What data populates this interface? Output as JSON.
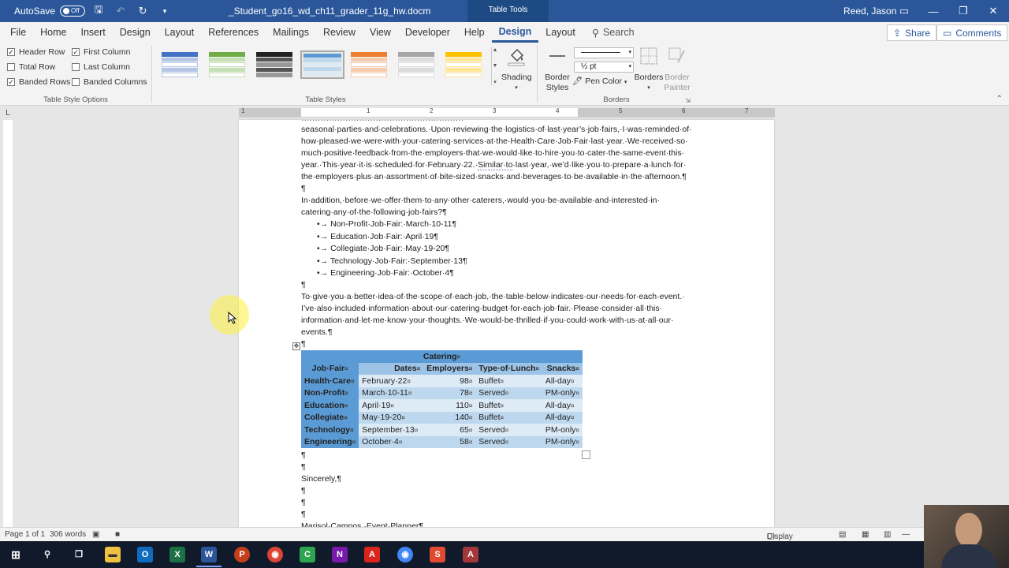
{
  "titlebar": {
    "autosave_label": "AutoSave",
    "autosave_state": "Off",
    "document_title": "_Student_go16_wd_ch11_grader_11g_hw.docm",
    "context_label": "Table Tools",
    "user": "Reed, Jason"
  },
  "menu": {
    "items": [
      "File",
      "Home",
      "Insert",
      "Design",
      "Layout",
      "References",
      "Mailings",
      "Review",
      "View",
      "Developer",
      "Help",
      "Design",
      "Layout"
    ],
    "search": "Search",
    "share": "Share",
    "comments": "Comments"
  },
  "ribbon": {
    "style_options": {
      "header_row": "Header Row",
      "total_row": "Total Row",
      "banded_rows": "Banded Rows",
      "first_column": "First Column",
      "last_column": "Last Column",
      "banded_columns": "Banded Columns",
      "group_label": "Table Style Options"
    },
    "table_styles_label": "Table Styles",
    "shading": "Shading",
    "border_styles_1": "Border",
    "border_styles_2": "Styles",
    "pen_weight": "½ pt",
    "pen_color": "Pen Color",
    "borders": "Borders",
    "border_painter_1": "Border",
    "border_painter_2": "Painter",
    "borders_group_label": "Borders"
  },
  "ruler": {
    "numbers": [
      "1",
      "1",
      "2",
      "3",
      "4",
      "5",
      "6",
      "7"
    ]
  },
  "document": {
    "lines": [
      "seasonal·parties·and·celebrations.·Upon·reviewing·the·logistics·of·last·year’s·job·fairs,·I·was·reminded·of·",
      "how·pleased·we·were·with·your·catering·services·at·the·Health·Care·Job·Fair·last·year.·We·received·so·",
      "much·positive·feedback·from·the·employers·that·we·would·like·to·hire·you·to·cater·the·same·event·this·",
      "year.·This·year·it·is·scheduled·for·February·22.·",
      "Similar·to",
      "·last·year,·we’d·like·you·to·prepare·a·lunch·for·",
      "the·employers·plus·an·assortment·of·bite-sized·snacks·and·beverages·to·be·available·in·the·afternoon.¶",
      "¶",
      "In·addition,·before·we·offer·them·to·any·other·caterers,·would·you·be·available·and·interested·in·",
      "catering·any·of·the·following·job·fairs?¶"
    ],
    "bullets": [
      "•→ Non-Profit·Job·Fair:·March·10-11¶",
      "•→ Education·Job·Fair:·April·19¶",
      "•→ Collegiate·Job·Fair:·May·19-20¶",
      "•→ Technology·Job·Fair:·September·13¶",
      "•→ Engineering·Job·Fair:·October·4¶"
    ],
    "pilcrow": "¶",
    "para2": [
      "To·give·you·a·better·idea·of·the·scope·of·each·job,·the·table·below·indicates·our·needs·for·each·event.·",
      "I’ve·also·included·information·about·our·catering·budget·for·each·job·fair.·Please·consider·all·this·",
      "information·and·let·me·know·your·thoughts.·We·would·be·thrilled·if·you·could·work·with·us·at·all·our·",
      "events.¶"
    ],
    "sincerely": "Sincerely,¶",
    "signature": "Marisol·Campos,·Event·Planner¶"
  },
  "table": {
    "title": "Catering",
    "cell_mark": "¤",
    "headers": [
      "Job·Fair",
      "Dates",
      "Employers",
      "Type·of·Lunch",
      "Snacks"
    ],
    "rows": [
      [
        "Health·Care",
        "February·22",
        "98",
        "Buffet",
        "All-day"
      ],
      [
        "Non-Profit",
        "March·10-11",
        "78",
        "Served",
        "PM-only"
      ],
      [
        "Education",
        "April·19",
        "110",
        "Buffet",
        "All-day"
      ],
      [
        "Collegiate",
        "May·19-20",
        "140",
        "Buffet",
        "All-day"
      ],
      [
        "Technology",
        "September·13",
        "65",
        "Served",
        "PM-only"
      ],
      [
        "Engineering",
        "October·4",
        "58",
        "Served",
        "PM-only"
      ]
    ]
  },
  "status": {
    "page": "Page 1 of 1",
    "words": "306 words",
    "display_settings": "Display Settings",
    "zoom_label": "—"
  },
  "colors": {
    "word_blue": "#2b579a",
    "table_title": "#5b9bd5",
    "band_a": "#ddebf7",
    "band_b": "#bdd7ee"
  }
}
